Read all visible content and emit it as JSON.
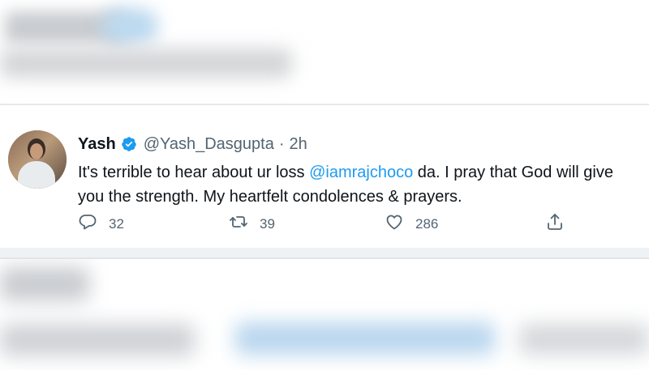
{
  "tweet": {
    "display_name": "Yash",
    "handle": "@Yash_Dasgupta",
    "separator": "·",
    "time": "2h",
    "text_line1_before": "It's terrible to hear about ur loss ",
    "mention": "@iamrajchoco",
    "text_line1_after": " da. I pray that God will give",
    "text_line2": "you the strength. My heartfelt condolences & prayers.",
    "reply_count": "32",
    "retweet_count": "39",
    "like_count": "286"
  },
  "icons": {
    "verified": "verified-badge-icon",
    "reply": "reply-icon",
    "retweet": "retweet-icon",
    "like": "heart-icon",
    "share": "share-icon"
  },
  "colors": {
    "accent": "#1d9bf0",
    "secondary_text": "#536471",
    "primary_text": "#0f1419"
  }
}
